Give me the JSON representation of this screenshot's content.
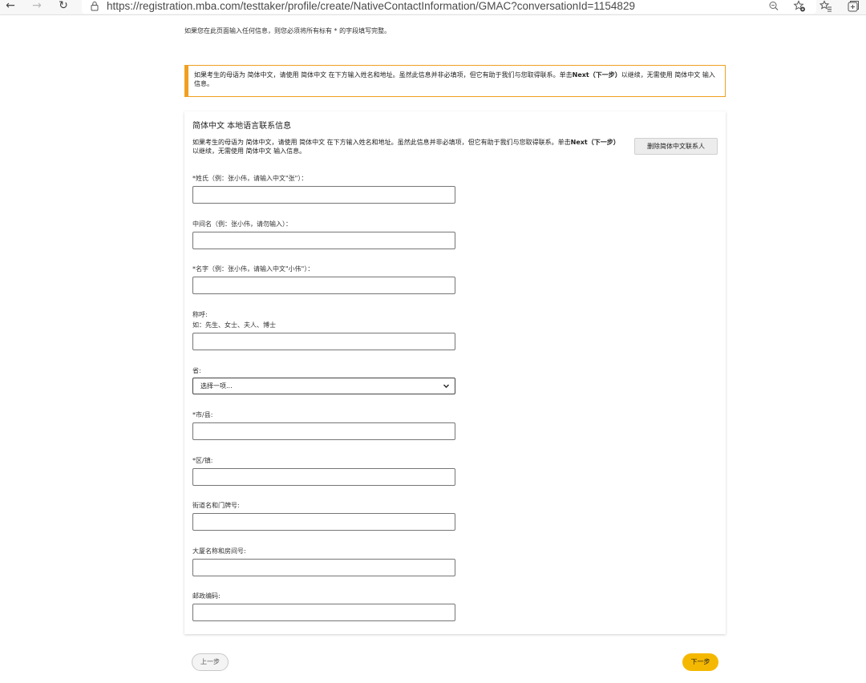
{
  "browser": {
    "url": "https://registration.mba.com/testtaker/profile/create/NativeContactInformation/GMAC?conversationId=1154829",
    "back_glyph": "←",
    "forward_glyph": "→",
    "refresh_glyph": "↻"
  },
  "page": {
    "intro_note": "如果您在此页面输入任何信息，则您必须将所有标有 * 的字段填写完整。",
    "notice": {
      "part1": "如果考生的母语为 简体中文，请使用 简体中文 在下方输入姓名和地址。虽然此信息并非必填项，但它有助于我们与您取得联系。单击",
      "bold": "Next（下一步）",
      "part2": "以继续，无需使用 简体中文 输入信息。",
      "accent_color": "#f0a020"
    },
    "card": {
      "title": "简体中文 本地语言联系信息",
      "desc_part1": "如果考生的母语为 简体中文，请使用 简体中文 在下方输入姓名和地址。虽然此信息并非必填项，但它有助于我们与您取得联系。单击",
      "desc_bold": "Next（下一步）",
      "desc_part2": "以继续，无需使用 简体中文 输入信息。",
      "delete_button": "删除简体中文联系人"
    },
    "fields": {
      "surname": {
        "label": "*姓氏（例：张小伟，请输入中文\"张\"）：",
        "value": ""
      },
      "middle_name": {
        "label": "中间名（例：张小伟，请勿输入）：",
        "value": ""
      },
      "given_name": {
        "label": "*名字（例：张小伟，请输入中文\"小伟\"）：",
        "value": ""
      },
      "salutation": {
        "label_line1": "称呼:",
        "label_line2": "如：先生、女士、夫人、博士",
        "value": ""
      },
      "province": {
        "label": "省:",
        "selected": "选择一项..."
      },
      "city": {
        "label": "*市/县:",
        "value": ""
      },
      "district": {
        "label": "*区/镇:",
        "value": ""
      },
      "street": {
        "label": "街道名和门牌号:",
        "value": ""
      },
      "building": {
        "label": "大厦名称和房间号:",
        "value": ""
      },
      "postal_code": {
        "label": "邮政编码:",
        "value": ""
      }
    },
    "buttons": {
      "prev": "上一步",
      "next": "下一步",
      "next_color": "#f5b800"
    }
  }
}
